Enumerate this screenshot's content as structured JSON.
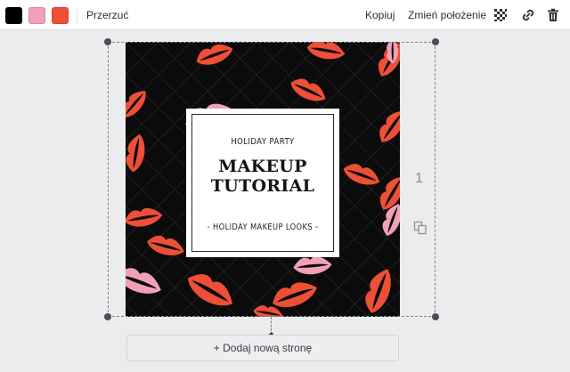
{
  "toolbar": {
    "swatches": [
      {
        "name": "black",
        "color": "#000000"
      },
      {
        "name": "pink",
        "color": "#f2a0b7"
      },
      {
        "name": "red",
        "color": "#ee4f36"
      }
    ],
    "transparency_label": "Przerzuć",
    "copy_label": "Kopiuj",
    "position_label": "Zmień położenie",
    "icons": [
      "transparency-icon",
      "link-icon",
      "trash-icon"
    ]
  },
  "design": {
    "background_color": "#0c0b0c",
    "lip_colors": [
      "#ee4f36",
      "#f2a0b7"
    ],
    "card": {
      "subtitle": "HOLIDAY PARTY",
      "title_line1": "MAKEUP",
      "title_line2": "TUTORIAL",
      "footer": "- HOLIDAY MAKEUP LOOKS -"
    }
  },
  "page_number": "1",
  "add_page_label": "+ Dodaj nową stronę"
}
